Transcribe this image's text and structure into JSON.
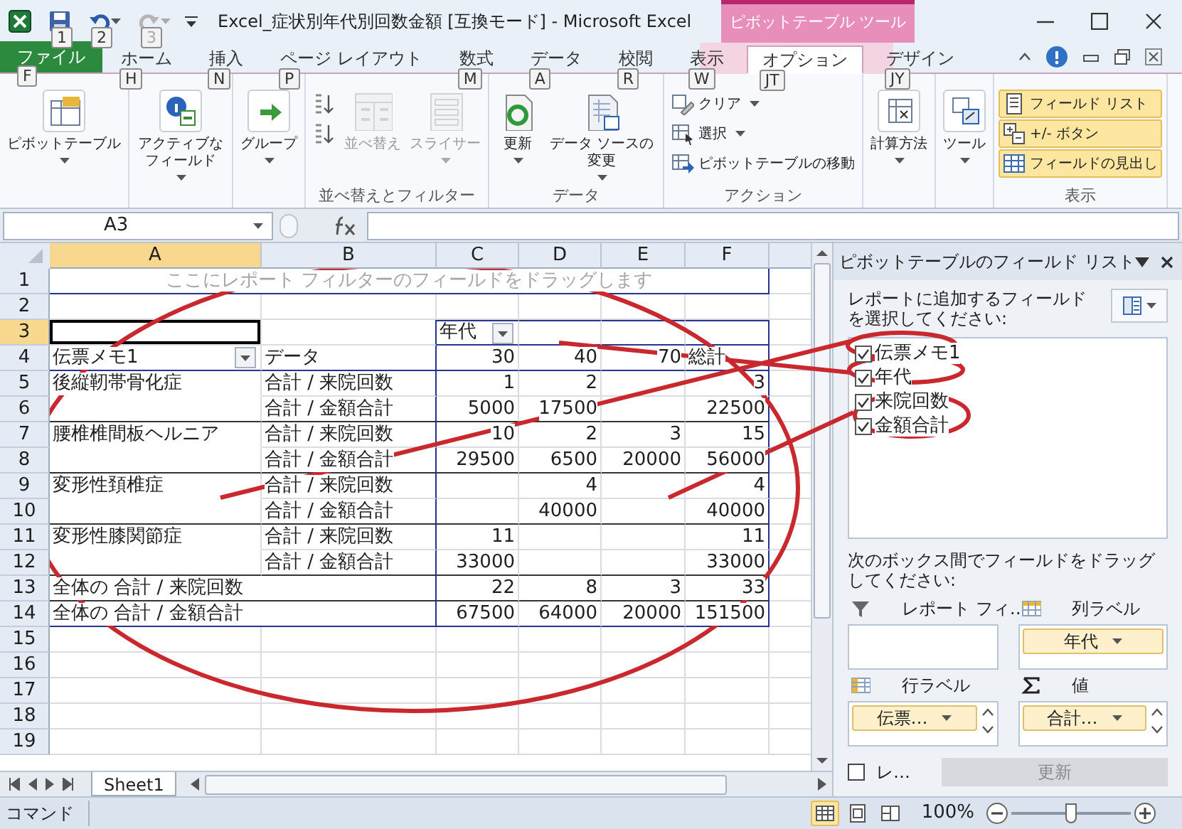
{
  "title_bar": {
    "title": "Excel_症状別年代別回数金額  [互換モード] - Microsoft Excel",
    "contextual_tab": "ピボットテーブル ツール",
    "qat_keytips": [
      "1",
      "2",
      "3"
    ]
  },
  "ribbon_tabs": [
    {
      "label": "ファイル",
      "keytip": "F",
      "kind": "file",
      "selected": false
    },
    {
      "label": "ホーム",
      "keytip": "H",
      "kind": "normal",
      "selected": false
    },
    {
      "label": "挿入",
      "keytip": "N",
      "kind": "normal",
      "selected": false
    },
    {
      "label": "ページ レイアウト",
      "keytip": "P",
      "kind": "normal",
      "selected": false
    },
    {
      "label": "数式",
      "keytip": "M",
      "kind": "normal",
      "selected": false
    },
    {
      "label": "データ",
      "keytip": "A",
      "kind": "normal",
      "selected": false
    },
    {
      "label": "校閲",
      "keytip": "R",
      "kind": "normal",
      "selected": false
    },
    {
      "label": "表示",
      "keytip": "W",
      "kind": "normal",
      "selected": false
    },
    {
      "label": "オプション",
      "keytip": "JT",
      "kind": "context",
      "selected": true
    },
    {
      "label": "デザイン",
      "keytip": "JY",
      "kind": "context",
      "selected": false
    }
  ],
  "ribbon_groups": [
    {
      "items": [
        {
          "kind": "pivot",
          "label": "ピボットテーブル",
          "dropdown": true
        }
      ]
    },
    {
      "items": [
        {
          "kind": "field",
          "label": "アクティブなフィールド",
          "dropdown": true
        }
      ]
    },
    {
      "items": [
        {
          "kind": "group",
          "label": "グループ",
          "dropdown": true
        }
      ]
    },
    {
      "label": "並べ替えとフィルター",
      "items": [
        {
          "kind": "sort_az",
          "disabled": false
        },
        {
          "kind": "sort_za",
          "disabled": false
        },
        {
          "kind": "sort",
          "label": "並べ替え",
          "disabled": true
        },
        {
          "kind": "slicer",
          "label": "スライサー",
          "dropdown": true,
          "disabled": true
        }
      ]
    },
    {
      "label": "データ",
      "items": [
        {
          "kind": "refresh",
          "label": "更新",
          "dropdown": true
        },
        {
          "kind": "source",
          "label": "データ ソースの変更",
          "dropdown": true
        }
      ]
    },
    {
      "label": "アクション",
      "items": [
        {
          "kind": "clear",
          "label": "クリア",
          "dropdown": true
        },
        {
          "kind": "select",
          "label": "選択",
          "dropdown": true
        },
        {
          "kind": "move",
          "label": "ピボットテーブルの移動"
        }
      ]
    },
    {
      "items": [
        {
          "kind": "calc",
          "label": "計算方法",
          "dropdown": true
        }
      ]
    },
    {
      "items": [
        {
          "kind": "tools",
          "label": "ツール",
          "dropdown": true
        }
      ]
    },
    {
      "label": "表示",
      "items": [
        {
          "kind": "fieldlist",
          "label": "フィールド リスト",
          "on": true
        },
        {
          "kind": "buttons",
          "label": "+/- ボタン",
          "on": true
        },
        {
          "kind": "headers",
          "label": "フィールドの見出し",
          "on": true
        }
      ]
    }
  ],
  "formula_bar": {
    "name_box": "A3"
  },
  "sheet": {
    "columns": [
      {
        "label": "A",
        "selected": true
      },
      {
        "label": "B",
        "selected": false
      },
      {
        "label": "C",
        "selected": false
      },
      {
        "label": "D",
        "selected": false
      },
      {
        "label": "E",
        "selected": false
      },
      {
        "label": "F",
        "selected": false
      }
    ],
    "rows": [
      {
        "number": "1",
        "selected": false,
        "kind": "filter_hint",
        "text": "ここにレポート フィルターのフィールドをドラッグします"
      },
      {
        "number": "2",
        "selected": false,
        "kind": "empty"
      },
      {
        "number": "3",
        "selected": true,
        "kind": "col_field",
        "cells": {
          "c": {
            "text": "年代",
            "dropdown": true
          }
        }
      },
      {
        "number": "4",
        "selected": false,
        "kind": "header",
        "cells": {
          "a": {
            "text": "伝票メモ1",
            "dropdown": true
          },
          "b": "データ",
          "c": "30",
          "d": "40",
          "e": "70",
          "f": "総計"
        }
      },
      {
        "number": "5",
        "selected": false,
        "kind": "data",
        "cells": {
          "a": "後縦靭帯骨化症",
          "b": "合計 / 来院回数",
          "c": "1",
          "d": "2",
          "f": "3"
        }
      },
      {
        "number": "6",
        "selected": false,
        "kind": "data",
        "cells": {
          "b": "合計 / 金額合計",
          "c": "5000",
          "d": "17500",
          "f": "22500"
        }
      },
      {
        "number": "7",
        "selected": false,
        "kind": "data",
        "cells": {
          "a": "腰椎椎間板ヘルニア",
          "b": "合計 / 来院回数",
          "c": "10",
          "d": "2",
          "e": "3",
          "f": "15"
        }
      },
      {
        "number": "8",
        "selected": false,
        "kind": "data",
        "cells": {
          "b": "合計 / 金額合計",
          "c": "29500",
          "d": "6500",
          "e": "20000",
          "f": "56000"
        }
      },
      {
        "number": "9",
        "selected": false,
        "kind": "data",
        "cells": {
          "a": "変形性頚椎症",
          "b": "合計 / 来院回数",
          "d": "4",
          "f": "4"
        }
      },
      {
        "number": "10",
        "selected": false,
        "kind": "data",
        "cells": {
          "b": "合計 / 金額合計",
          "d": "40000",
          "f": "40000"
        }
      },
      {
        "number": "11",
        "selected": false,
        "kind": "data",
        "cells": {
          "a": "変形性膝関節症",
          "b": "合計 / 来院回数",
          "c": "11",
          "f": "11"
        }
      },
      {
        "number": "12",
        "selected": false,
        "kind": "data",
        "cells": {
          "b": "合計 / 金額合計",
          "c": "33000",
          "f": "33000"
        }
      },
      {
        "number": "13",
        "selected": false,
        "kind": "grand_total",
        "cells": {
          "a": "全体の 合計 / 来院回数",
          "c": "22",
          "d": "8",
          "e": "3",
          "f": "33"
        }
      },
      {
        "number": "14",
        "selected": false,
        "kind": "grand_total",
        "cells": {
          "a": "全体の 合計 / 金額合計",
          "c": "67500",
          "d": "64000",
          "e": "20000",
          "f": "151500"
        }
      },
      {
        "number": "15",
        "selected": false,
        "kind": "empty"
      },
      {
        "number": "16",
        "selected": false,
        "kind": "empty"
      },
      {
        "number": "17",
        "selected": false,
        "kind": "empty"
      },
      {
        "number": "18",
        "selected": false,
        "kind": "empty"
      },
      {
        "number": "19",
        "selected": false,
        "kind": "empty"
      }
    ]
  },
  "sheet_tabs": [
    {
      "label": "Sheet1",
      "selected": true
    }
  ],
  "field_list": {
    "title": "ピボットテーブルのフィールド リスト",
    "instruction": "レポートに追加するフィールドを選択してください:",
    "fields": [
      {
        "label": "伝票メモ1",
        "checked": true
      },
      {
        "label": "年代",
        "checked": true
      },
      {
        "label": "来院回数",
        "checked": true
      },
      {
        "label": "金額合計",
        "checked": true
      }
    ],
    "drag_instruction": "次のボックス間でフィールドをドラッグしてください:",
    "areas": [
      {
        "kind": "filter",
        "label": "レポート フィ…"
      },
      {
        "kind": "column",
        "label": "列ラベル",
        "items": [
          {
            "label": "年代"
          }
        ]
      },
      {
        "kind": "row",
        "label": "行ラベル",
        "items": [
          {
            "label": "伝票…"
          }
        ]
      },
      {
        "kind": "values",
        "label": "値",
        "items": [
          {
            "label": "合計…"
          }
        ]
      }
    ],
    "defer_update": {
      "label": "レ…",
      "checked": false
    },
    "update_button": {
      "label": "更新",
      "disabled": true
    }
  },
  "status_bar": {
    "mode": "コマンド",
    "views": [
      {
        "kind": "normal",
        "selected": true
      },
      {
        "kind": "page_layout",
        "selected": false
      },
      {
        "kind": "page_break",
        "selected": false
      }
    ],
    "zoom": "100%",
    "zoom_slider": {
      "level": 0.5
    }
  }
}
